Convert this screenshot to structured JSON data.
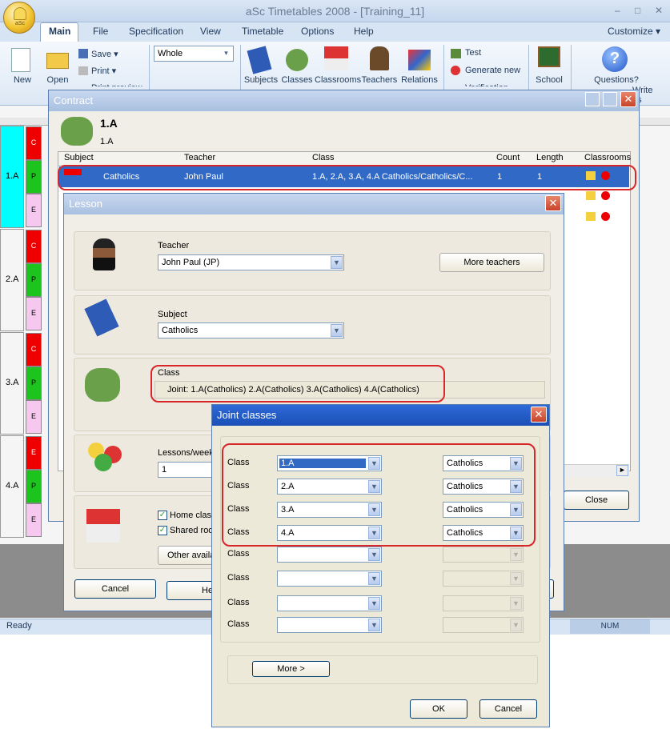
{
  "app": {
    "title": "aSc Timetables 2008 - [Training_11]",
    "orb_label": "aSc"
  },
  "menu": {
    "tabs": [
      "Main",
      "File",
      "Specification",
      "View",
      "Timetable",
      "Options",
      "Help"
    ],
    "customize": "Customize ▾"
  },
  "ribbon": {
    "new": "New",
    "open": "Open",
    "save": "Save ▾",
    "print": "Print ▾",
    "print_more": "Print preview",
    "whole_combo": "Whole",
    "subjects": "Subjects",
    "classes": "Classes",
    "classrooms": "Classrooms",
    "teachers": "Teachers",
    "relations": "Relations",
    "test": "Test",
    "generate_new": "Generate new",
    "verification": "Verification",
    "school": "School",
    "questions": "Questions?",
    "write_us": "Write us"
  },
  "grid": {
    "rows": [
      {
        "label": "1.A",
        "cells": [
          "C",
          "P",
          "E"
        ]
      },
      {
        "label": "2.A",
        "cells": [
          "C",
          "P",
          "E"
        ]
      },
      {
        "label": "3.A",
        "cells": [
          "C",
          "P",
          "E"
        ]
      },
      {
        "label": "4.A",
        "cells": [
          "E",
          "P",
          "E"
        ]
      }
    ]
  },
  "status": {
    "text": "Ready",
    "num": "NUM"
  },
  "contract": {
    "title": "Contract",
    "class_big": "1.A",
    "class_small": "1.A",
    "columns": [
      "Subject",
      "Teacher",
      "Class",
      "Count",
      "Length",
      "Classrooms"
    ],
    "rows": [
      {
        "subject": "Catholics",
        "teacher": "John Paul",
        "class": "1.A, 2.A, 3.A, 4.A Catholics/Catholics/C...",
        "count": "1",
        "length": "1"
      }
    ],
    "close": "Close"
  },
  "lesson": {
    "title": "Lesson",
    "teacher_label": "Teacher",
    "teacher_value": "John Paul (JP)",
    "more_teachers": "More teachers",
    "subject_label": "Subject",
    "subject_value": "Catholics",
    "class_label": "Class",
    "class_value": "Joint: 1.A(Catholics) 2.A(Catholics) 3.A(Catholics) 4.A(Catholics)",
    "lessons_label": "Lessons/week",
    "lessons_value": "1",
    "home_class": "Home classroom",
    "shared": "Shared room",
    "other": "Other available",
    "cancel": "Cancel",
    "help": "Help"
  },
  "joint": {
    "title": "Joint classes",
    "rows": [
      {
        "label": "Class",
        "class": "1.A",
        "group": "Catholics"
      },
      {
        "label": "Class",
        "class": "2.A",
        "group": "Catholics"
      },
      {
        "label": "Class",
        "class": "3.A",
        "group": "Catholics"
      },
      {
        "label": "Class",
        "class": "4.A",
        "group": "Catholics"
      },
      {
        "label": "Class",
        "class": "",
        "group": ""
      },
      {
        "label": "Class",
        "class": "",
        "group": ""
      },
      {
        "label": "Class",
        "class": "",
        "group": ""
      },
      {
        "label": "Class",
        "class": "",
        "group": ""
      }
    ],
    "more": "More >",
    "ok": "OK",
    "cancel": "Cancel"
  }
}
